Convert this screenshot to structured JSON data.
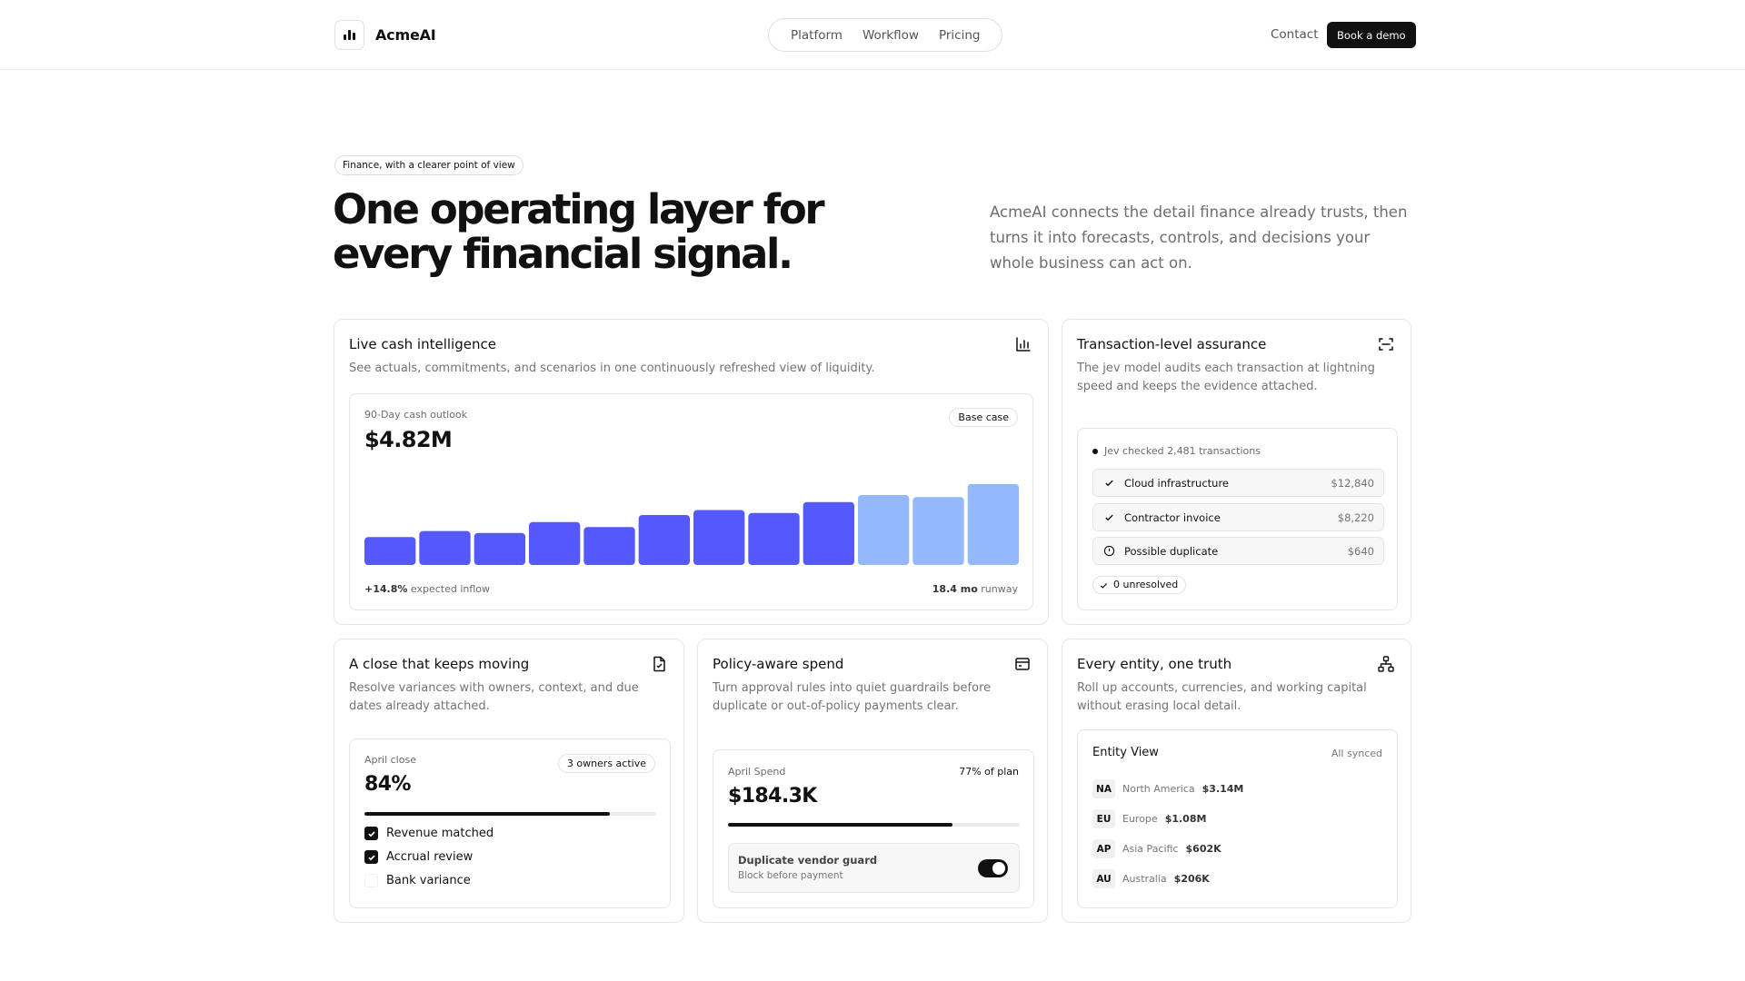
{
  "header": {
    "brand": "AcmeAI",
    "nav": [
      "Platform",
      "Workflow",
      "Pricing"
    ],
    "contact": "Contact",
    "cta": "Book a demo"
  },
  "hero": {
    "pill": "Finance, with a clearer point of view",
    "title_line1": "One operating layer for",
    "title_line2": "every financial signal.",
    "subtitle": "AcmeAI connects the detail finance already trusts, then turns it into forecasts, controls, and decisions your whole business can act on."
  },
  "cash": {
    "title": "Live cash intelligence",
    "description": "See actuals, commitments, and scenarios in one continuously refreshed view of liquidity.",
    "icon": "bar-chart-icon",
    "outlook_label": "90-Day cash outlook",
    "value": "$4.82M",
    "badge": "Base case",
    "inflow_value": "+14.8%",
    "inflow_label": "expected inflow",
    "runway_value": "18.4 mo",
    "runway_label": "runway"
  },
  "chart_data": {
    "type": "bar",
    "values": [
      28,
      34,
      32,
      43,
      38,
      50,
      55,
      52,
      63,
      70,
      68,
      81
    ],
    "ylim": [
      0,
      100
    ],
    "colors": {
      "actual": "#5558fb",
      "forecast": "#93b8fb"
    },
    "forecast_start_index": 9
  },
  "assurance": {
    "title": "Transaction-level assurance",
    "description": "The jev model audits each transaction at lightning speed and keeps the evidence attached.",
    "icon": "scan-icon",
    "checked": "Jev checked 2,481 transactions",
    "rows": [
      {
        "name": "Cloud infrastructure",
        "amount": "$12,840",
        "status": "check"
      },
      {
        "name": "Contractor invoice",
        "amount": "$8,220",
        "status": "check"
      },
      {
        "name": "Possible duplicate",
        "amount": "$640",
        "status": "alert"
      }
    ],
    "unresolved": "0 unresolved"
  },
  "close": {
    "title": "A close that keeps moving",
    "description": "Resolve variances with owners, context, and due dates already attached.",
    "icon": "document-icon",
    "label": "April close",
    "badge": "3 owners active",
    "value": "84%",
    "progress": 0.84,
    "items": [
      {
        "label": "Revenue matched",
        "checked": true
      },
      {
        "label": "Accrual review",
        "checked": true
      },
      {
        "label": "Bank variance",
        "checked": false
      }
    ]
  },
  "spend": {
    "title": "Policy-aware spend",
    "description": "Turn approval rules into quiet guardrails before duplicate or out-of-policy payments clear.",
    "icon": "card-icon",
    "label": "April Spend",
    "plan": "77% of plan",
    "value": "$184.3K",
    "progress": 0.77,
    "guard_title": "Duplicate vendor guard",
    "guard_sub": "Block before payment",
    "guard_on": true
  },
  "entity": {
    "title": "Every entity, one truth",
    "description": "Roll up accounts, currencies, and working capital without erasing local detail.",
    "icon": "network-icon",
    "view_title": "Entity View",
    "synced": "All synced",
    "rows": [
      {
        "code": "NA",
        "name": "North America",
        "value": "$3.14M"
      },
      {
        "code": "EU",
        "name": "Europe",
        "value": "$1.08M"
      },
      {
        "code": "AP",
        "name": "Asia Pacific",
        "value": "$602K"
      },
      {
        "code": "AU",
        "name": "Australia",
        "value": "$206K"
      }
    ]
  }
}
